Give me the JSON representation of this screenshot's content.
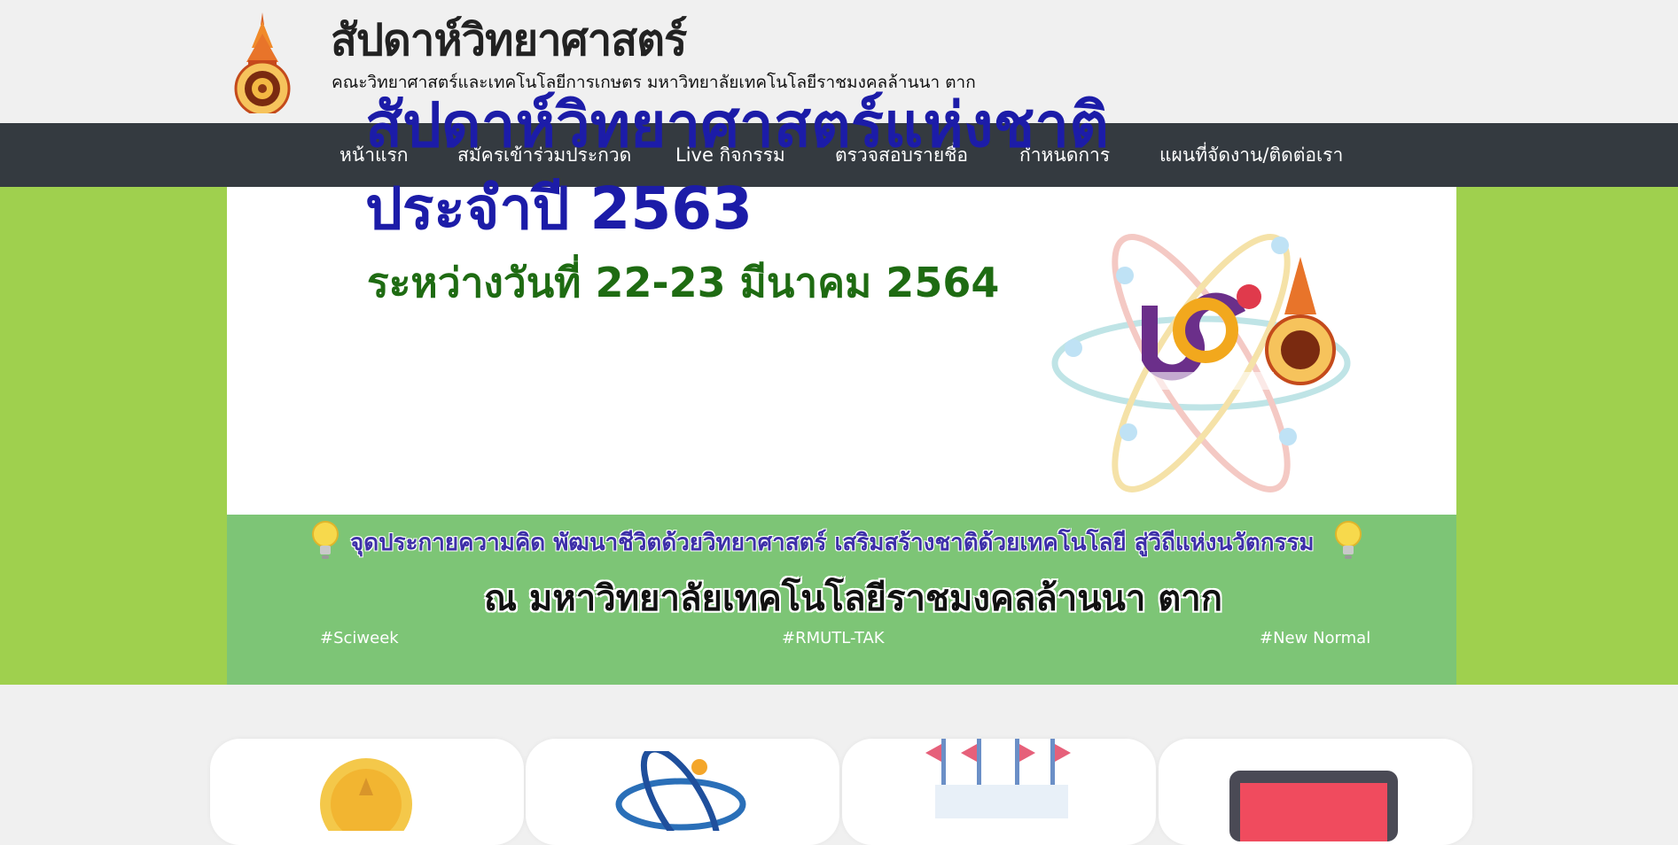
{
  "site": {
    "title": "สัปดาห์วิทยาศาสตร์",
    "subtitle": "คณะวิทยาศาสตร์และเทคโนโลยีการเกษตร มหาวิทยาลัยเทคโนโลยีราชมงคลล้านนา ตาก"
  },
  "nav": {
    "items": [
      {
        "label": "หน้าแรก"
      },
      {
        "label": "สมัครเข้าร่วมประกวด"
      },
      {
        "label": "Live กิจกรรม"
      },
      {
        "label": "ตรวจสอบรายชื่อ"
      },
      {
        "label": "กำหนดการ"
      },
      {
        "label": "แผนที่จัดงาน/ติดต่อเรา"
      }
    ]
  },
  "banner": {
    "line1": "สัปดาห์วิทยาศาสตร์แห่งชาติ",
    "line2": "ประจำปี 2563",
    "dates": "ระหว่างวันที่ 22-23 มีนาคม 2564",
    "slogan": "จุดประกายความคิด พัฒนาชีวิตด้วยวิทยาศาสตร์ เสริมสร้างชาติด้วยเทคโนโลยี สู่วิถีแห่งนวัตกรรม",
    "venue": "ณ มหาวิทยาลัยเทคโนโลยีราชมงคลล้านนา ตาก",
    "hashtags": [
      "#Sciweek",
      "#RMUTL-TAK",
      "#New Normal"
    ]
  },
  "colors": {
    "nav_bg": "#343a40",
    "hero_green": "#9fd04e",
    "banner_green": "#7dc576",
    "title_blue": "#1c1ca8",
    "date_green": "#1e6b12"
  },
  "icons": [
    "university-emblem-icon",
    "atom-logo-icon",
    "lightbulb-icon",
    "medal-icon",
    "atom-icon",
    "flags-icon",
    "monitor-icon"
  ]
}
